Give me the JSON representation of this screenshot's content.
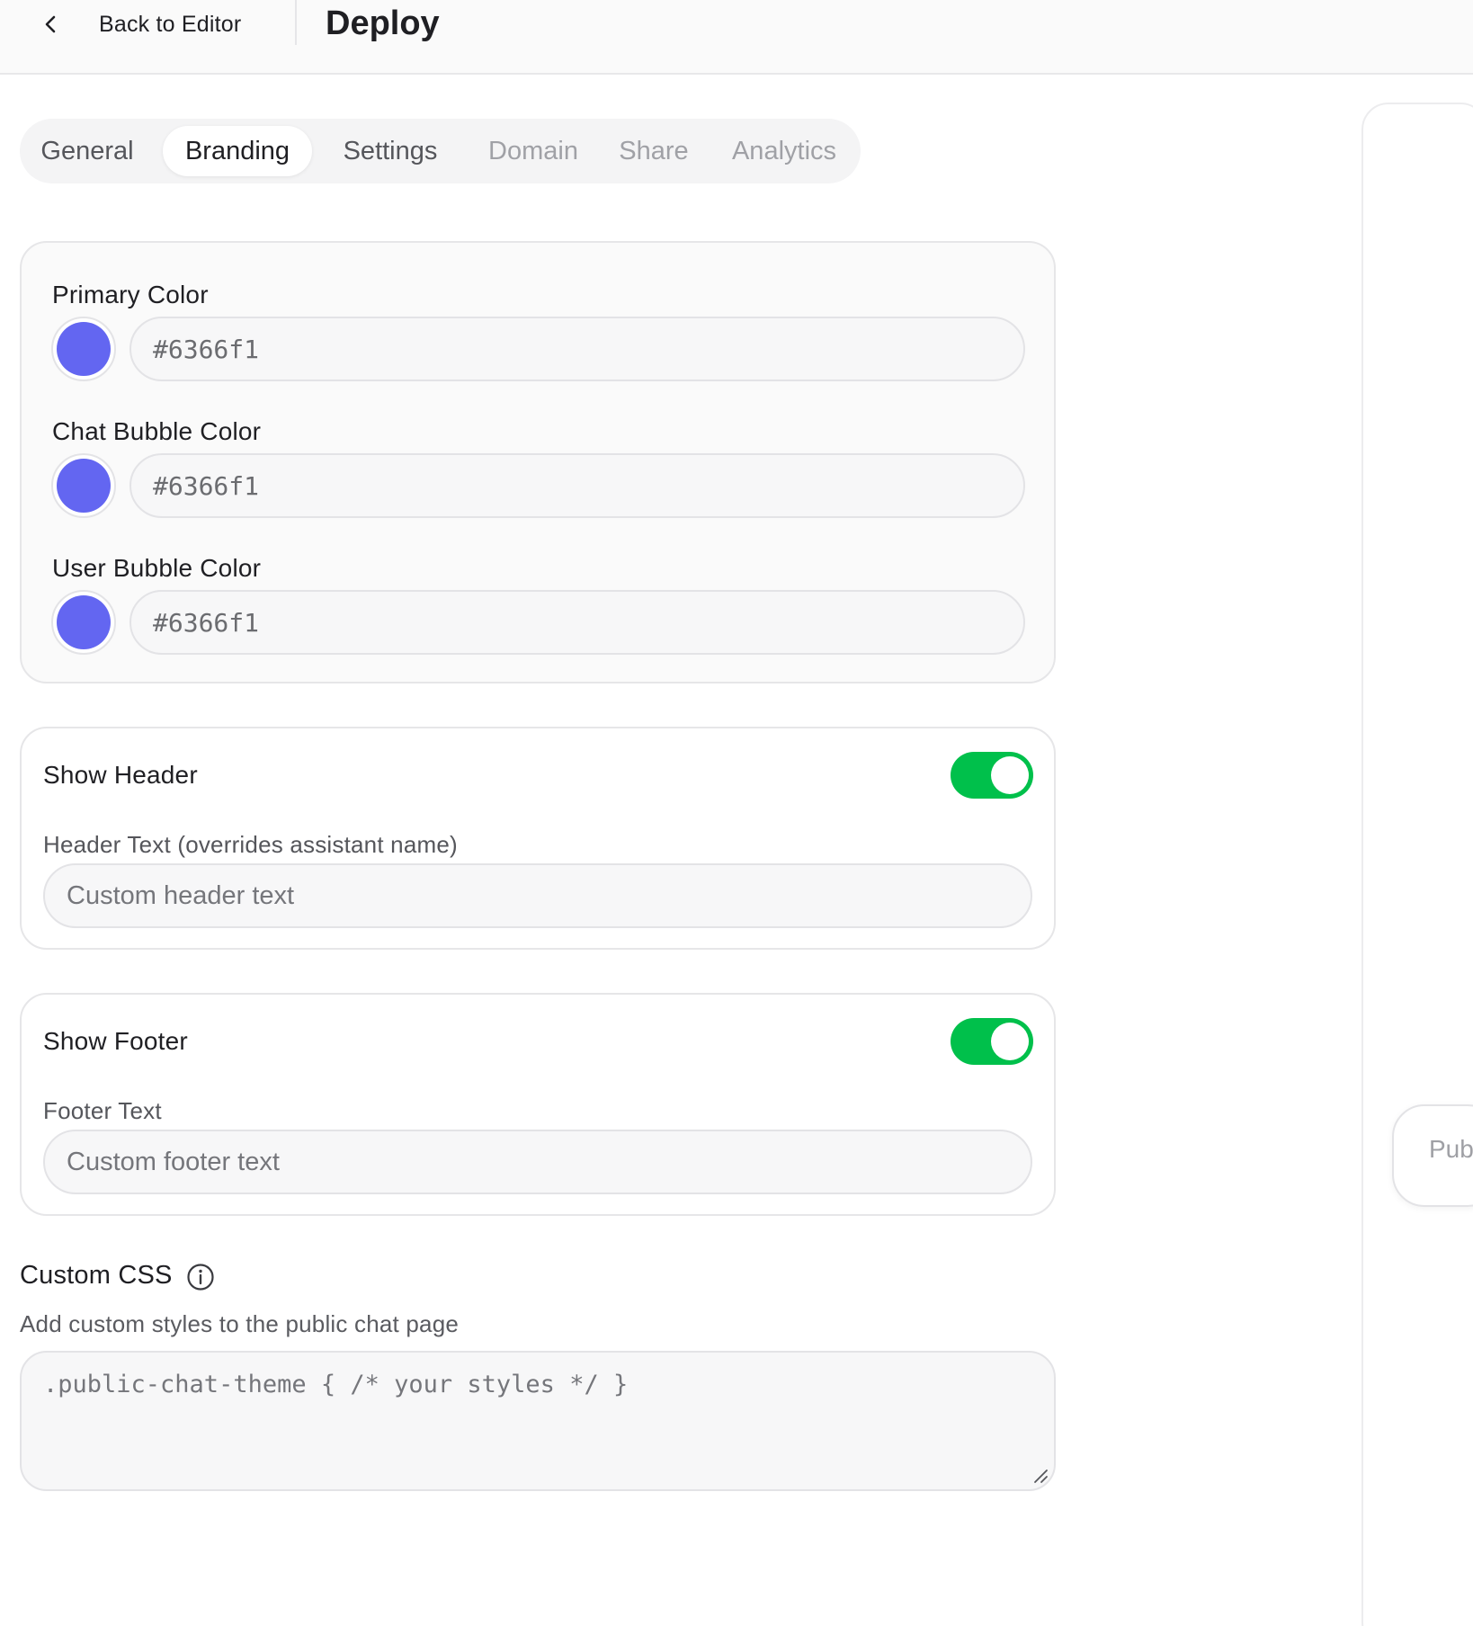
{
  "header": {
    "back_label": "Back to Editor",
    "title": "Deploy"
  },
  "tabs": [
    {
      "label": "General",
      "state": "enabled"
    },
    {
      "label": "Branding",
      "state": "active"
    },
    {
      "label": "Settings",
      "state": "enabled"
    },
    {
      "label": "Domain",
      "state": "disabled"
    },
    {
      "label": "Share",
      "state": "disabled"
    },
    {
      "label": "Analytics",
      "state": "disabled"
    }
  ],
  "colors": {
    "primary": {
      "label": "Primary Color",
      "value": "#6366f1"
    },
    "chat_bubble": {
      "label": "Chat Bubble Color",
      "value": "#6366f1"
    },
    "user_bubble": {
      "label": "User Bubble Color",
      "value": "#6366f1"
    }
  },
  "show_header": {
    "title": "Show Header",
    "enabled": true,
    "text_label": "Header Text (overrides assistant name)",
    "placeholder": "Custom header text",
    "value": ""
  },
  "show_footer": {
    "title": "Show Footer",
    "enabled": true,
    "text_label": "Footer Text",
    "placeholder": "Custom footer text",
    "value": ""
  },
  "custom_css": {
    "title": "Custom CSS",
    "description": "Add custom styles to the public chat page",
    "placeholder": ".public-chat-theme { /* your styles */ }"
  },
  "preview": {
    "publish_label": "Pub"
  },
  "theme": {
    "toggle_on": "#00c04b",
    "swatch": "#6366f1"
  }
}
